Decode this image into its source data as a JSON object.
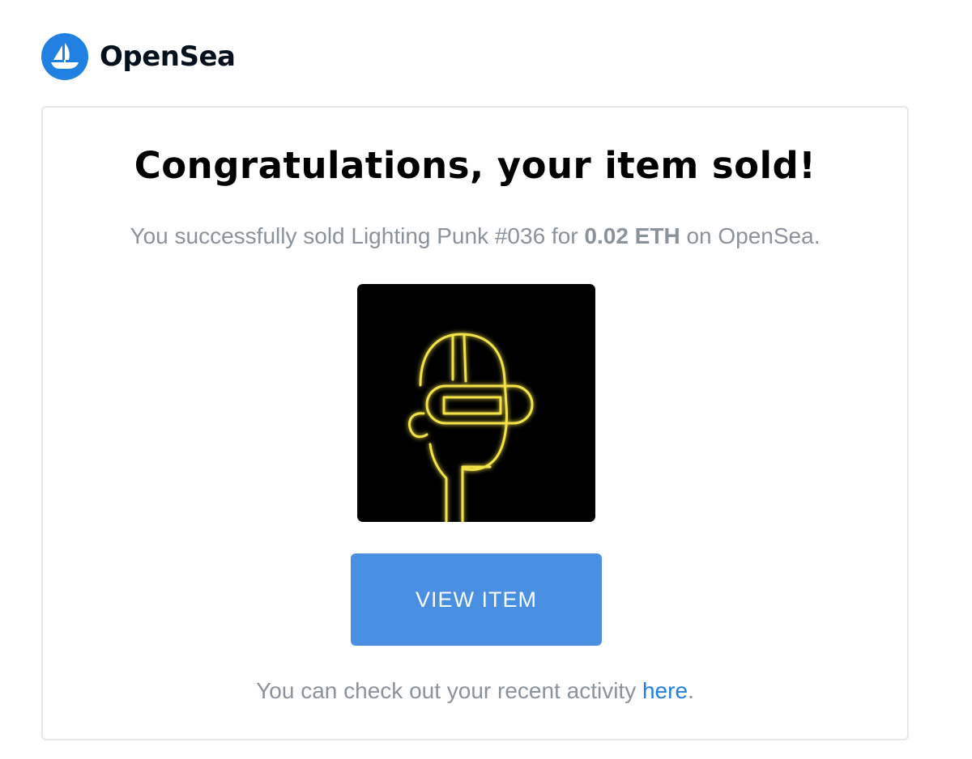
{
  "brand": {
    "name": "OpenSea",
    "logo_icon": "sailboat-icon",
    "color": "#2081e2"
  },
  "email": {
    "title": "Congratulations, your item sold!",
    "message_prefix": "You successfully sold Lighting Punk #036 for",
    "price": "0.02 ETH",
    "message_suffix": "on OpenSea.",
    "item_image": "lighting-punk-nft-image",
    "button_label": "VIEW ITEM",
    "button_color": "#4a90e2",
    "footer_prefix": "You can check out your recent activity",
    "footer_link": "here",
    "footer_suffix": "."
  }
}
